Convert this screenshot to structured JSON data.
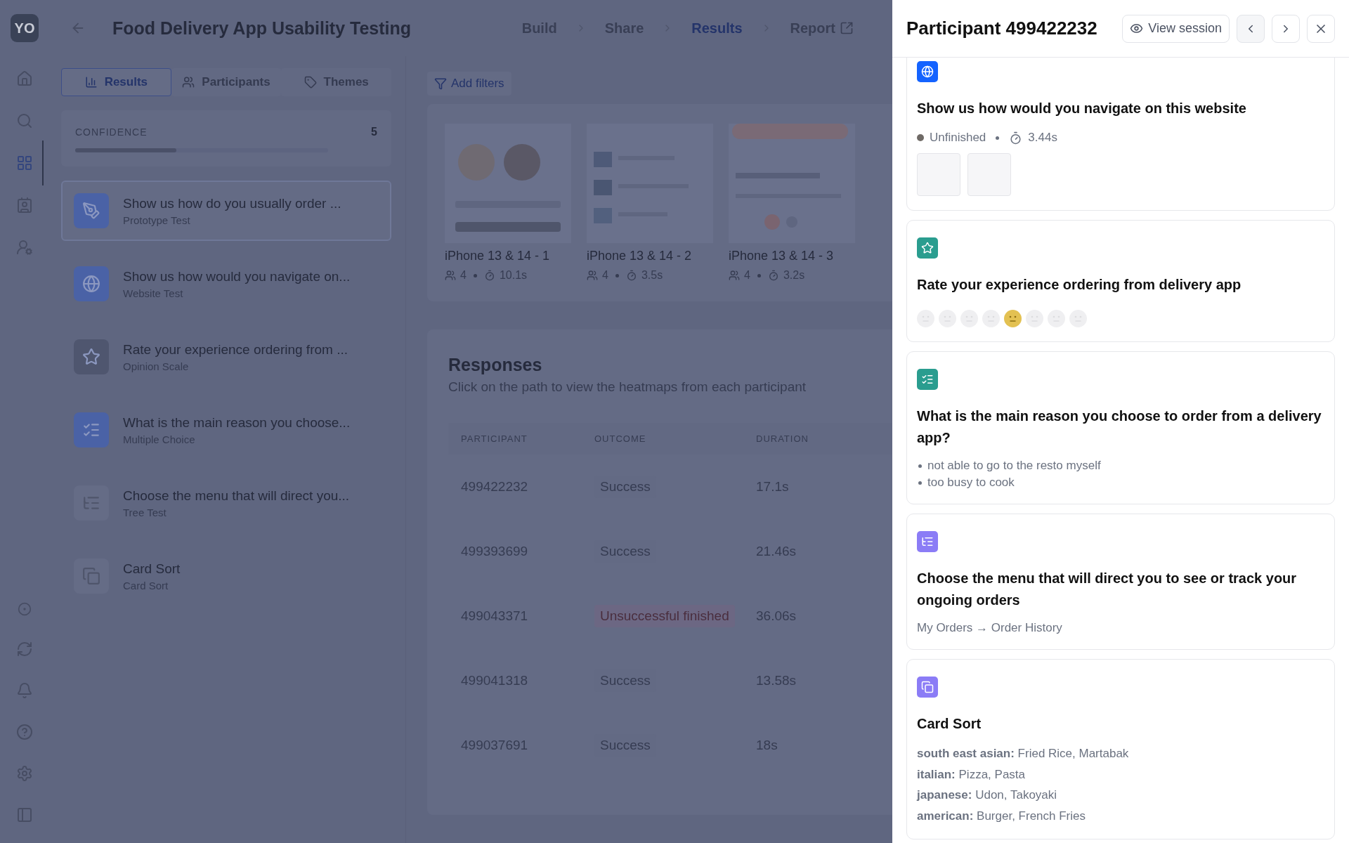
{
  "app": {
    "logo": "YO",
    "title": "Food Delivery App Usability Testing",
    "steps": [
      {
        "label": "Build",
        "selected": false
      },
      {
        "label": "Share",
        "selected": false
      },
      {
        "label": "Results",
        "selected": true
      },
      {
        "label": "Report",
        "selected": false,
        "external": true
      }
    ]
  },
  "sidebar": {
    "items": [
      {
        "kind": "home",
        "selected": false
      },
      {
        "kind": "search",
        "selected": false
      },
      {
        "kind": "grid",
        "selected": true
      },
      {
        "kind": "contacts",
        "selected": false
      },
      {
        "kind": "user",
        "selected": false
      }
    ],
    "bottom_items": [
      {
        "kind": "circle"
      },
      {
        "kind": "refresh"
      },
      {
        "kind": "bell"
      },
      {
        "kind": "help"
      },
      {
        "kind": "settings"
      },
      {
        "kind": "panel"
      }
    ]
  },
  "tabs": [
    {
      "label": "Results",
      "selected": true
    },
    {
      "label": "Participants",
      "selected": false
    },
    {
      "label": "Themes",
      "selected": false
    }
  ],
  "confidence": {
    "label": "CONFIDENCE",
    "value": "5",
    "level": 0.4
  },
  "blocks": [
    {
      "title": "Show us how do you usually order ...",
      "type": "Prototype Test",
      "kind": "prototype",
      "color": "#4a62a6",
      "selected": true
    },
    {
      "title": "Show us how would you navigate on...",
      "type": "Website Test",
      "kind": "website",
      "color": "#4a62a6",
      "selected": false
    },
    {
      "title": "Rate your experience ordering from ...",
      "type": "Opinion Scale",
      "kind": "opinion",
      "color": "#4f566f",
      "selected": false
    },
    {
      "title": "What is the main reason you choose...",
      "type": "Multiple Choice",
      "kind": "multiple_choice",
      "color": "#4a62a6",
      "selected": false
    },
    {
      "title": "Choose the menu that will direct you...",
      "type": "Tree Test",
      "kind": "tree",
      "color": "#656c86",
      "selected": false
    },
    {
      "title": "Card Sort",
      "type": "Card Sort",
      "kind": "card_sort",
      "color": "#656c86",
      "selected": false
    }
  ],
  "filters_button": "Add filters",
  "screens": [
    {
      "name": "iPhone 13 & 14 - 1",
      "participants": "4",
      "duration": "10.1s"
    },
    {
      "name": "iPhone 13 & 14 - 2",
      "participants": "4",
      "duration": "3.5s"
    },
    {
      "name": "iPhone 13 & 14 - 3",
      "participants": "4",
      "duration": "3.2s"
    }
  ],
  "responses": {
    "title": "Responses",
    "subtitle": "Click on the path to view the heatmaps from each participant",
    "columns": [
      "PARTICIPANT",
      "OUTCOME",
      "DURATION"
    ],
    "rows": [
      {
        "participant": "499422232",
        "outcome": "Success",
        "kind": "success",
        "duration": "17.1s"
      },
      {
        "participant": "499393699",
        "outcome": "Success",
        "kind": "success",
        "duration": "21.46s"
      },
      {
        "participant": "499043371",
        "outcome": "Unsuccessful finished",
        "kind": "fail",
        "duration": "36.06s"
      },
      {
        "participant": "499041318",
        "outcome": "Success",
        "kind": "success",
        "duration": "13.58s"
      },
      {
        "participant": "499037691",
        "outcome": "Success",
        "kind": "success",
        "duration": "18s"
      }
    ]
  },
  "drawer": {
    "title": "Participant 499422232",
    "view_session": "View session",
    "cards": [
      {
        "kind": "website",
        "title": "Show us how would you navigate on this website",
        "status": "Unfinished",
        "duration": "3.44s",
        "thumbnails": [
          {
            "kind": "blank"
          },
          {
            "kind": "blank"
          }
        ]
      },
      {
        "kind": "opinion",
        "title": "Rate your experience ordering from delivery app",
        "faces": [
          {
            "selected": false
          },
          {
            "selected": false
          },
          {
            "selected": false
          },
          {
            "selected": false
          },
          {
            "selected": true
          },
          {
            "selected": false
          },
          {
            "selected": false
          },
          {
            "selected": false
          }
        ]
      },
      {
        "kind": "multiple_choice",
        "title": "What is the main reason you choose to order from a delivery app?",
        "answers": [
          "not able to go to the resto myself",
          "too busy to cook"
        ]
      },
      {
        "kind": "tree",
        "title": "Choose the menu that will direct you to see or track your ongoing orders",
        "path": "My Orders → Order History"
      },
      {
        "kind": "card_sort",
        "title": "Card Sort",
        "groups": [
          "**south east asian:** Fried Rice, Martabak",
          "**italian:** Pizza, Pasta",
          "**japanese:** Udon, Takoyaki",
          "**american:** Burger, French Fries"
        ]
      }
    ]
  }
}
